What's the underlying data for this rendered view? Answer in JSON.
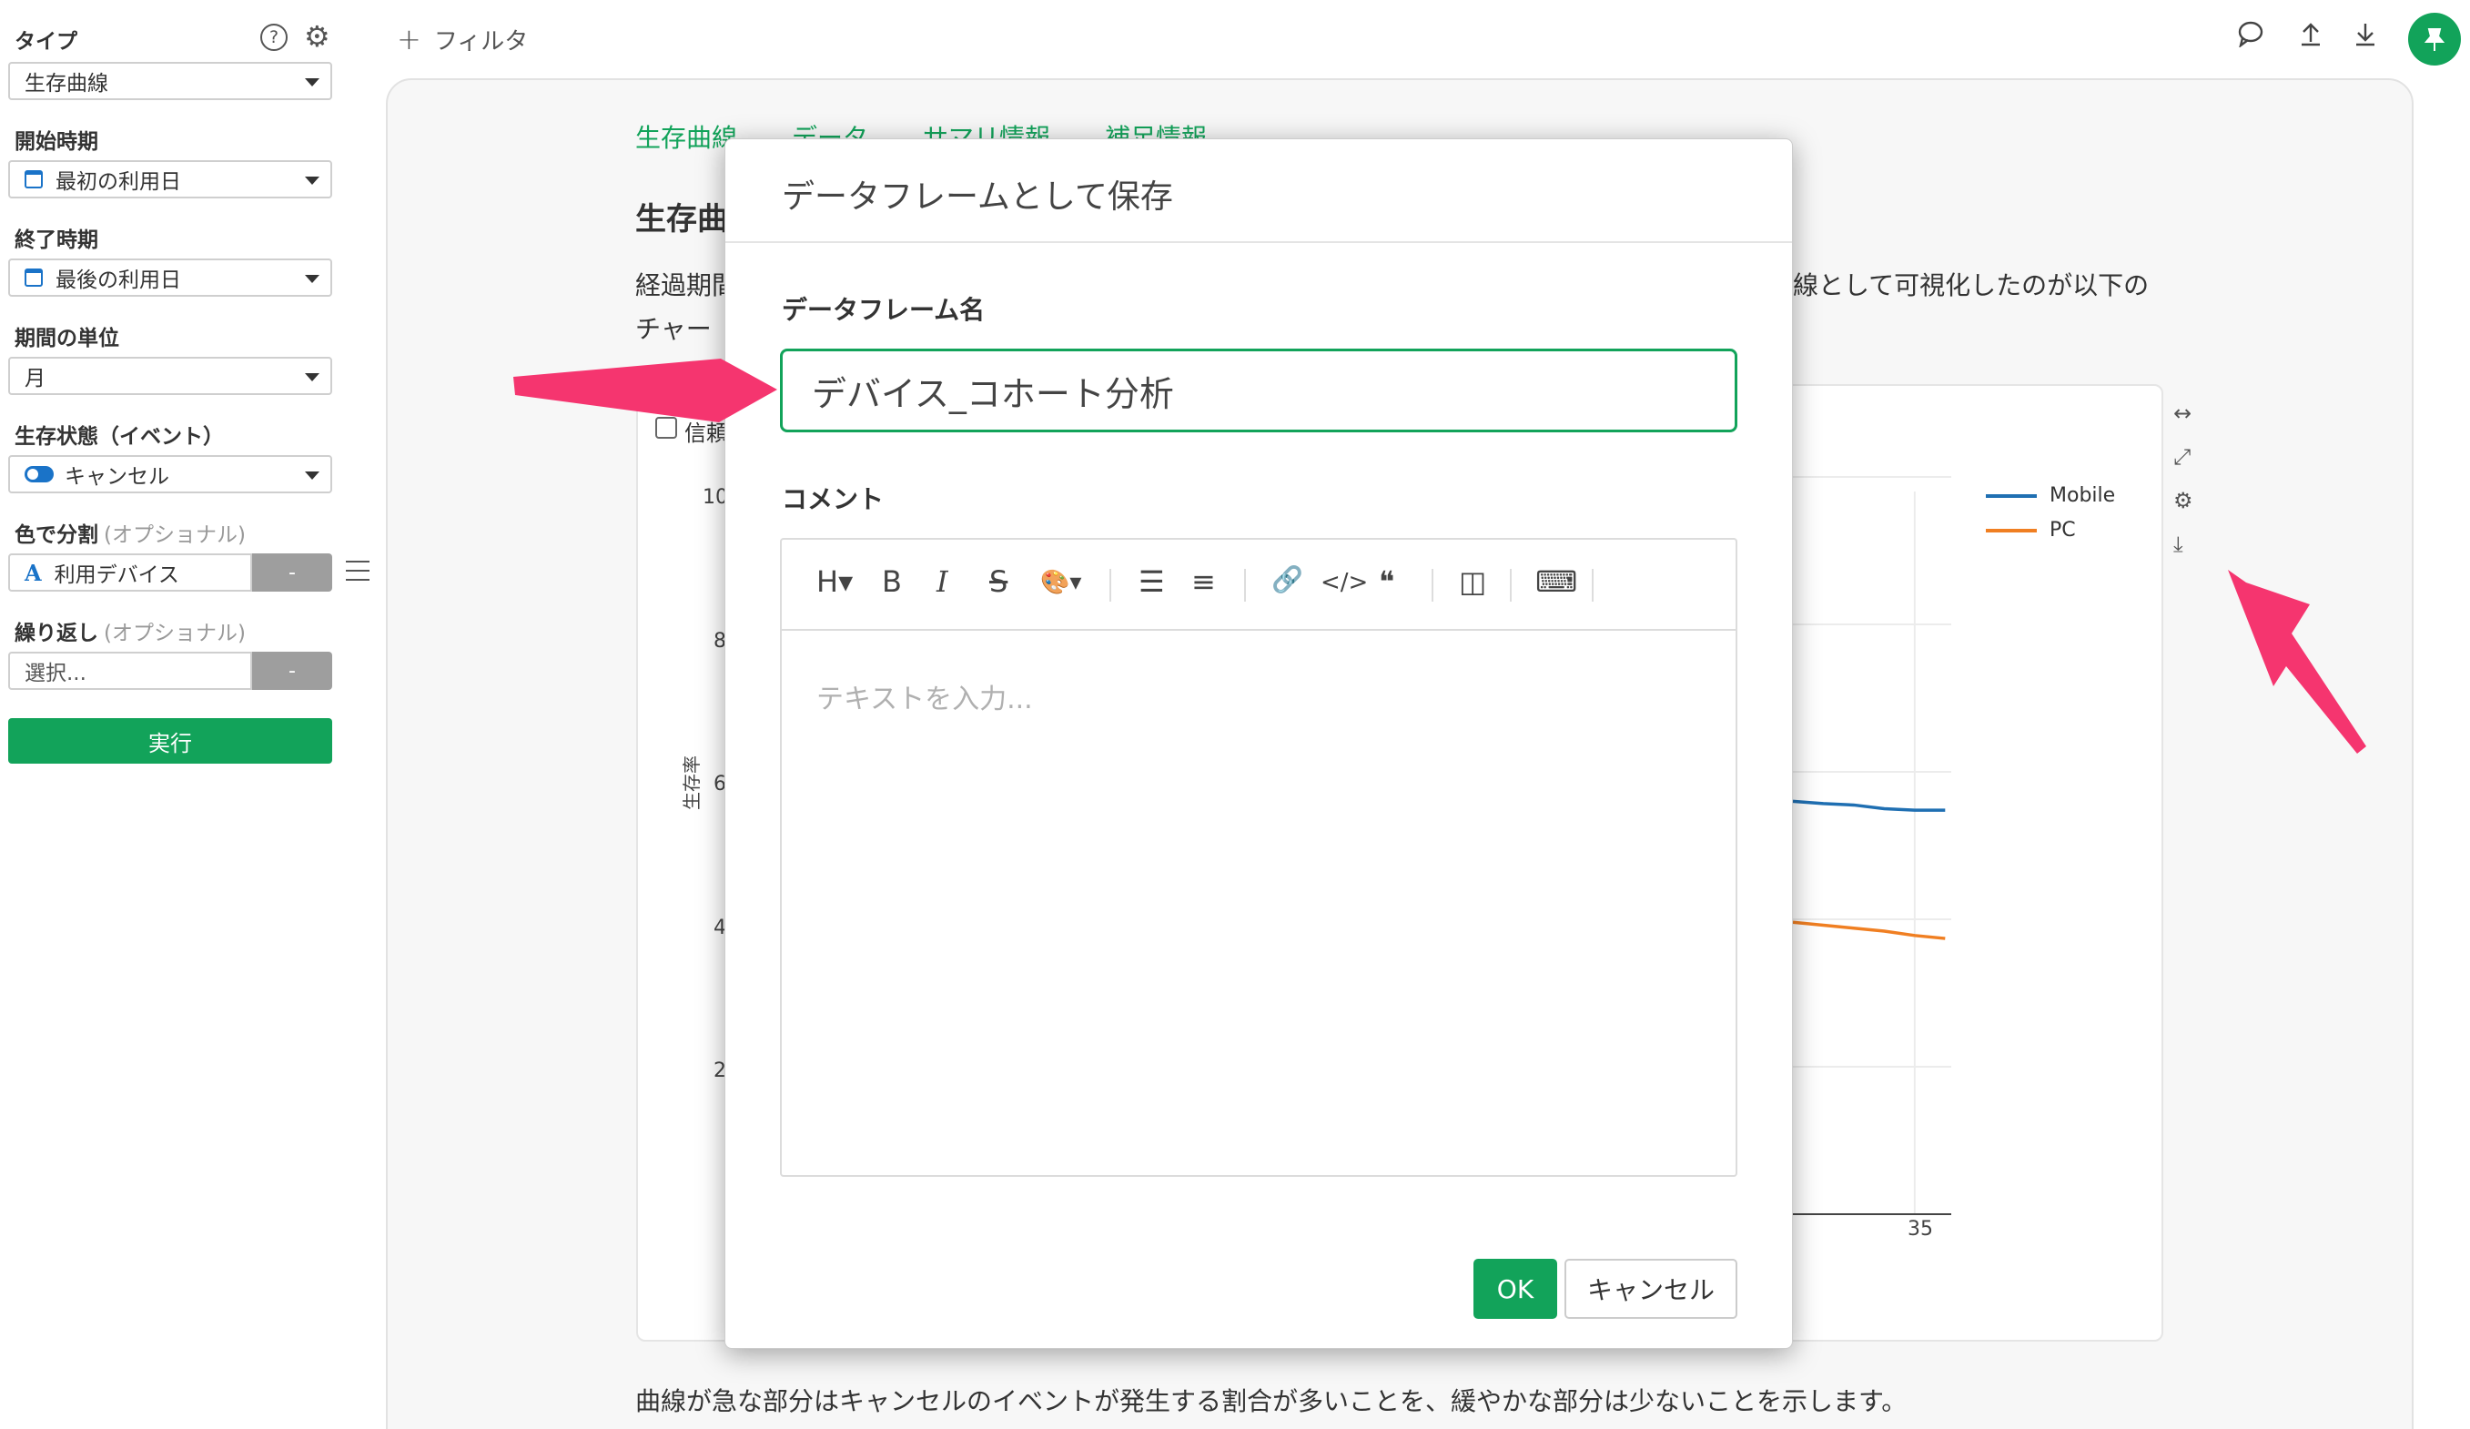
{
  "sidebar": {
    "type_label": "タイプ",
    "type_value": "生存曲線",
    "help_icon": "?",
    "start_label": "開始時期",
    "start_value": "最初の利用日",
    "end_label": "終了時期",
    "end_value": "最後の利用日",
    "unit_label": "期間の単位",
    "unit_value": "月",
    "event_label": "生存状態（イベント）",
    "event_value": "キャンセル",
    "color_label": "色で分割",
    "color_optional": "(オプショナル)",
    "color_value": "利用デバイス",
    "color_icon": "A",
    "dash": "-",
    "repeat_label": "繰り返し",
    "repeat_optional": "(オプショナル)",
    "repeat_placeholder": "選択...",
    "run_label": "実行"
  },
  "topbar": {
    "filter_plus": "+",
    "filter_label": "フィルタ",
    "comment_icon": "💬",
    "upload_icon": "⤒",
    "download_icon": "⤓",
    "pin_icon": "📌"
  },
  "main": {
    "tabs": [
      "生存曲線",
      "データ",
      "サマリ情報",
      "補足情報"
    ],
    "section_title": "生存曲",
    "para1_left": "経過期間",
    "para1_right": "線として可視化したのが以下の",
    "para2_left": "チャー",
    "bottom_text": "曲線が急な部分はキャンセルのイベントが発生する割合が多いことを、緩やかな部分は少ないことを示します。"
  },
  "chart": {
    "ci_label": "信頼",
    "ylabel": "生存率",
    "ytick_labels": [
      "10",
      "8",
      "6",
      "4",
      "2"
    ],
    "xtick_label": "35",
    "legend": [
      {
        "name": "Mobile",
        "color": "#1f6fb2"
      },
      {
        "name": "PC",
        "color": "#f07f22"
      }
    ],
    "side_icons": [
      "↔",
      "⤢",
      "⚙",
      "⤓"
    ]
  },
  "chart_data": {
    "type": "line",
    "title": "",
    "xlabel": "",
    "ylabel": "生存率",
    "xtick_visible": [
      35
    ],
    "series": [
      {
        "name": "Mobile",
        "color": "#1f6fb2",
        "x": [
          31,
          32,
          33,
          34,
          35,
          36
        ],
        "y": [
          0.56,
          0.557,
          0.555,
          0.55,
          0.548,
          0.548
        ]
      },
      {
        "name": "PC",
        "color": "#f07f22",
        "x": [
          31,
          32,
          33,
          34,
          35,
          36
        ],
        "y": [
          0.396,
          0.392,
          0.388,
          0.384,
          0.378,
          0.374
        ]
      }
    ]
  },
  "modal": {
    "title": "データフレームとして保存",
    "name_label": "データフレーム名",
    "name_value": "デバイス_コホート分析",
    "comment_label": "コメント",
    "comment_placeholder": "テキストを入力...",
    "toolbar": {
      "heading": "H▾",
      "bold": "B",
      "italic": "I",
      "strike": "S",
      "color": "🎨▾",
      "bullet": "☰",
      "numbered": "≡",
      "link": "🔗",
      "code": "</>",
      "quote": "❝",
      "preview": "◫",
      "keyboard": "⌨"
    },
    "ok_label": "OK",
    "cancel_label": "キャンセル"
  }
}
